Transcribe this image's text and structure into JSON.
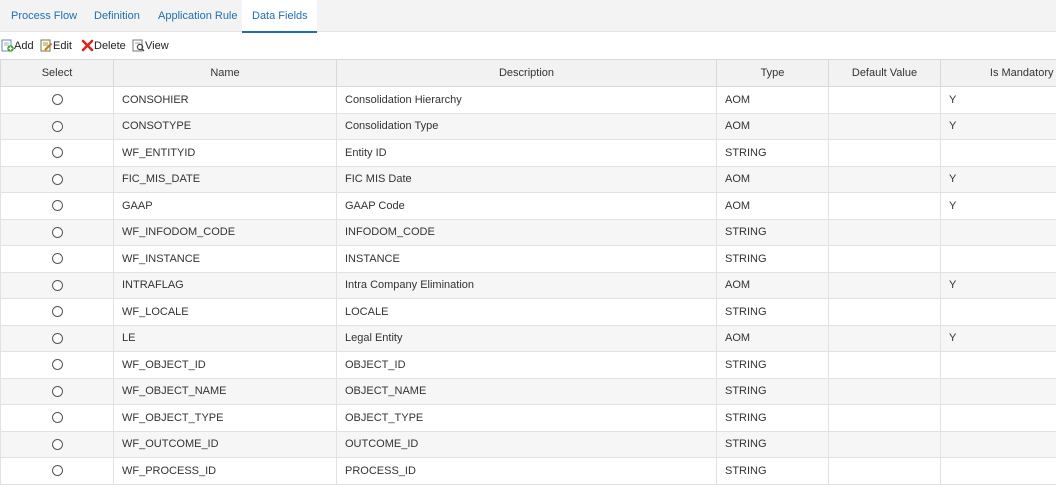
{
  "tabs": [
    {
      "label": "Process Flow",
      "active": false
    },
    {
      "label": "Definition",
      "active": false
    },
    {
      "label": "Application Rule",
      "active": false
    },
    {
      "label": "Data Fields",
      "active": true
    }
  ],
  "toolbar": {
    "add_label": "Add",
    "edit_label": "Edit",
    "delete_label": "Delete",
    "view_label": "View"
  },
  "table": {
    "headers": {
      "select": "Select",
      "name": "Name",
      "description": "Description",
      "type": "Type",
      "default_value": "Default Value",
      "is_mandatory": "Is Mandatory"
    },
    "rows": [
      {
        "name": "CONSOHIER",
        "description": "Consolidation Hierarchy",
        "type": "AOM",
        "default_value": "",
        "is_mandatory": "Y"
      },
      {
        "name": "CONSOTYPE",
        "description": "Consolidation Type",
        "type": "AOM",
        "default_value": "",
        "is_mandatory": "Y"
      },
      {
        "name": "WF_ENTITYID",
        "description": "Entity ID",
        "type": "STRING",
        "default_value": "",
        "is_mandatory": ""
      },
      {
        "name": "FIC_MIS_DATE",
        "description": "FIC MIS Date",
        "type": "AOM",
        "default_value": "",
        "is_mandatory": "Y"
      },
      {
        "name": "GAAP",
        "description": "GAAP Code",
        "type": "AOM",
        "default_value": "",
        "is_mandatory": "Y"
      },
      {
        "name": "WF_INFODOM_CODE",
        "description": "INFODOM_CODE",
        "type": "STRING",
        "default_value": "",
        "is_mandatory": ""
      },
      {
        "name": "WF_INSTANCE",
        "description": "INSTANCE",
        "type": "STRING",
        "default_value": "",
        "is_mandatory": ""
      },
      {
        "name": "INTRAFLAG",
        "description": "Intra Company Elimination",
        "type": "AOM",
        "default_value": "",
        "is_mandatory": "Y"
      },
      {
        "name": "WF_LOCALE",
        "description": "LOCALE",
        "type": "STRING",
        "default_value": "",
        "is_mandatory": ""
      },
      {
        "name": "LE",
        "description": "Legal Entity",
        "type": "AOM",
        "default_value": "",
        "is_mandatory": "Y"
      },
      {
        "name": "WF_OBJECT_ID",
        "description": "OBJECT_ID",
        "type": "STRING",
        "default_value": "",
        "is_mandatory": ""
      },
      {
        "name": "WF_OBJECT_NAME",
        "description": "OBJECT_NAME",
        "type": "STRING",
        "default_value": "",
        "is_mandatory": ""
      },
      {
        "name": "WF_OBJECT_TYPE",
        "description": "OBJECT_TYPE",
        "type": "STRING",
        "default_value": "",
        "is_mandatory": ""
      },
      {
        "name": "WF_OUTCOME_ID",
        "description": "OUTCOME_ID",
        "type": "STRING",
        "default_value": "",
        "is_mandatory": ""
      },
      {
        "name": "WF_PROCESS_ID",
        "description": "PROCESS_ID",
        "type": "STRING",
        "default_value": "",
        "is_mandatory": ""
      }
    ]
  },
  "icons": {
    "add": "add-icon",
    "edit": "edit-icon",
    "delete": "delete-icon",
    "view": "view-icon"
  },
  "colors": {
    "tab_link": "#1f6fb0",
    "delete_red": "#d9261c",
    "add_green": "#3a9a2a"
  }
}
